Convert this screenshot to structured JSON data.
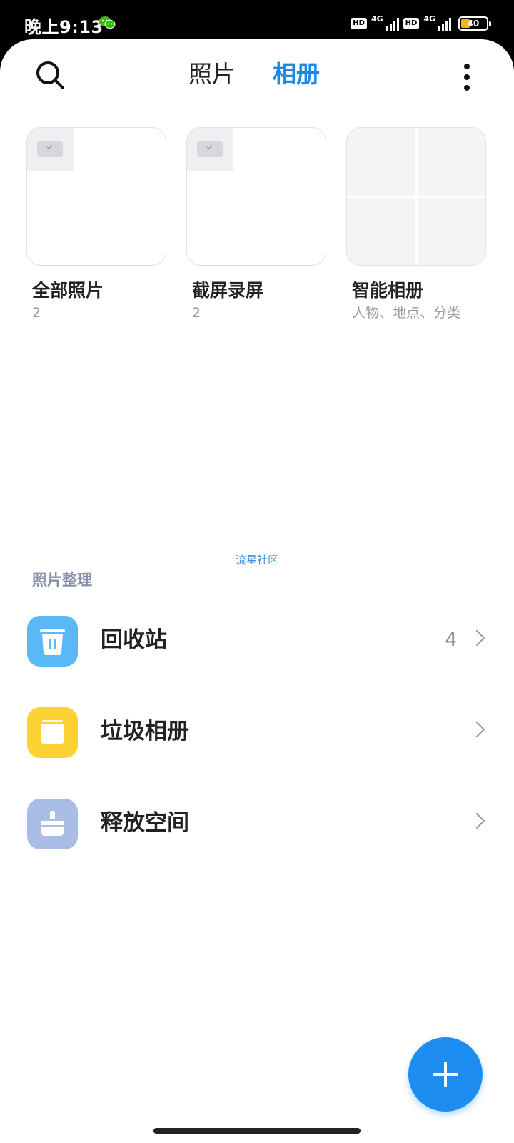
{
  "status_bar": {
    "time": "晚上9:13",
    "network_1": "4G",
    "network_2": "4G",
    "hd_label": "HD",
    "battery": "40",
    "icons": [
      "wechat-icon",
      "signal-icon",
      "battery-icon"
    ]
  },
  "header": {
    "tabs": [
      {
        "label": "照片",
        "selected": false
      },
      {
        "label": "相册",
        "selected": true
      }
    ],
    "search_icon": "search-icon",
    "more_icon": "more-vertical-icon",
    "accent_color": "#1e88e5"
  },
  "albums": [
    {
      "name": "全部照片",
      "subtitle": "2"
    },
    {
      "name": "截屏录屏",
      "subtitle": "2"
    },
    {
      "name": "智能相册",
      "subtitle": "人物、地点、分类"
    }
  ],
  "watermark": "流星社区",
  "organize": {
    "title": "照片整理",
    "items": [
      {
        "label": "回收站",
        "count": "4",
        "icon": "trash-icon",
        "color": "#5bb8f7"
      },
      {
        "label": "垃圾相册",
        "count": "",
        "icon": "junk-album-icon",
        "color": "#fcd235"
      },
      {
        "label": "释放空间",
        "count": "",
        "icon": "broom-icon",
        "color": "#a9bde6"
      }
    ]
  },
  "fab": {
    "icon": "plus-icon"
  }
}
